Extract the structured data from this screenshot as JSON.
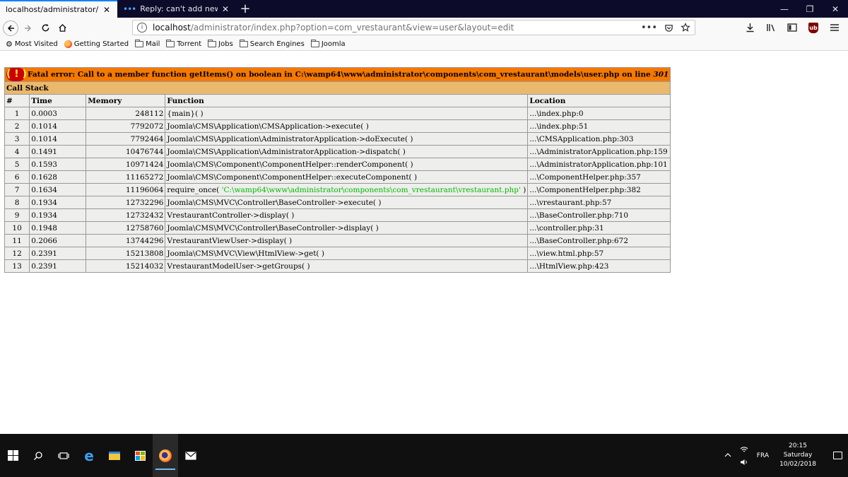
{
  "browser": {
    "tabs": [
      {
        "label": "localhost/administrator/index.php?",
        "active": true
      },
      {
        "label": "Reply: can't add new users in V",
        "active": false
      }
    ],
    "new_tab": "+",
    "window_controls": {
      "minimize": "—",
      "restore": "❐",
      "close": "✕"
    },
    "url": {
      "host": "localhost",
      "rest": "/administrator/index.php?option=com_vrestaurant&view=user&layout=edit"
    },
    "url_actions": {
      "more": "•••"
    },
    "bookmarks": [
      {
        "label": "Most Visited",
        "icon": "gear-icon"
      },
      {
        "label": "Getting Started",
        "icon": "firefox-icon"
      },
      {
        "label": "Mail",
        "icon": "folder-icon"
      },
      {
        "label": "Torrent",
        "icon": "folder-icon"
      },
      {
        "label": "Jobs",
        "icon": "folder-icon"
      },
      {
        "label": "Search Engines",
        "icon": "folder-icon"
      },
      {
        "label": "Joomla",
        "icon": "folder-icon"
      }
    ]
  },
  "error": {
    "icon": "( ! )",
    "message": "Fatal error: Call to a member function getItems() on boolean in C:\\wamp64\\www\\administrator\\components\\com_vrestaurant\\models\\user.php on line ",
    "line": "301",
    "stack_title": "Call Stack",
    "headers": [
      "#",
      "Time",
      "Memory",
      "Function",
      "Location"
    ],
    "rows": [
      {
        "n": "1",
        "time": "0.0003",
        "memory": "248112",
        "function": "{main}( )",
        "location": "...\\index.php:0"
      },
      {
        "n": "2",
        "time": "0.1014",
        "memory": "7792072",
        "function": "Joomla\\CMS\\Application\\CMSApplication->execute( )",
        "location": "...\\index.php:51"
      },
      {
        "n": "3",
        "time": "0.1014",
        "memory": "7792464",
        "function": "Joomla\\CMS\\Application\\AdministratorApplication->doExecute( )",
        "location": "...\\CMSApplication.php:303"
      },
      {
        "n": "4",
        "time": "0.1491",
        "memory": "10476744",
        "function": "Joomla\\CMS\\Application\\AdministratorApplication->dispatch( )",
        "location": "...\\AdministratorApplication.php:159"
      },
      {
        "n": "5",
        "time": "0.1593",
        "memory": "10971424",
        "function": "Joomla\\CMS\\Component\\ComponentHelper::renderComponent( )",
        "location": "...\\AdministratorApplication.php:101"
      },
      {
        "n": "6",
        "time": "0.1628",
        "memory": "11165272",
        "function": "Joomla\\CMS\\Component\\ComponentHelper::executeComponent( )",
        "location": "...\\ComponentHelper.php:357"
      },
      {
        "n": "7",
        "time": "0.1634",
        "memory": "11196064",
        "function": "require_once( ",
        "include_path": "'C:\\wamp64\\www\\administrator\\components\\com_vrestaurant\\vrestaurant.php'",
        "function_tail": " )",
        "location": "...\\ComponentHelper.php:382"
      },
      {
        "n": "8",
        "time": "0.1934",
        "memory": "12732296",
        "function": "Joomla\\CMS\\MVC\\Controller\\BaseController->execute( )",
        "location": "...\\vrestaurant.php:57"
      },
      {
        "n": "9",
        "time": "0.1934",
        "memory": "12732432",
        "function": "VrestaurantController->display( )",
        "location": "...\\BaseController.php:710"
      },
      {
        "n": "10",
        "time": "0.1948",
        "memory": "12758760",
        "function": "Joomla\\CMS\\MVC\\Controller\\BaseController->display( )",
        "location": "...\\controller.php:31"
      },
      {
        "n": "11",
        "time": "0.2066",
        "memory": "13744296",
        "function": "VrestaurantViewUser->display( )",
        "location": "...\\BaseController.php:672"
      },
      {
        "n": "12",
        "time": "0.2391",
        "memory": "15213808",
        "function": "Joomla\\CMS\\MVC\\View\\HtmlView->get( )",
        "location": "...\\view.html.php:57"
      },
      {
        "n": "13",
        "time": "0.2391",
        "memory": "15214032",
        "function": "VrestaurantModelUser->getGroups( )",
        "location": "...\\HtmlView.php:423"
      }
    ]
  },
  "taskbar": {
    "tray_lang": "FRA",
    "time": "20:15",
    "day": "Saturday",
    "date": "10/02/2018"
  },
  "colors": {
    "error_header": "#f57900",
    "stack_header": "#e9b96e",
    "cell_bg": "#eeeeec",
    "include_path": "#00bb00"
  }
}
